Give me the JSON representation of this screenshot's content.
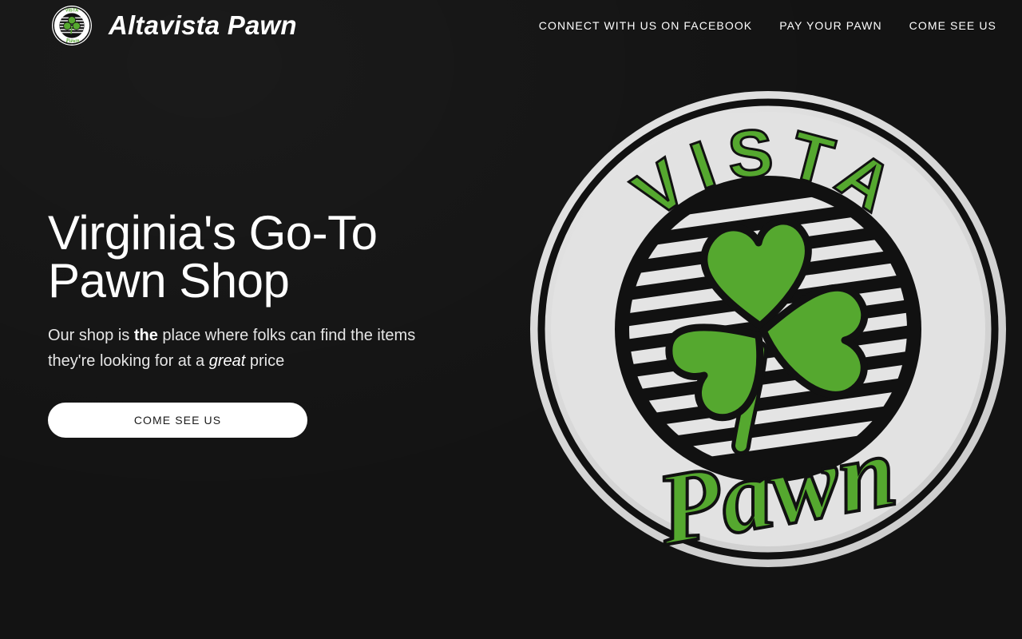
{
  "header": {
    "brand_name": "Altavista Pawn",
    "logo_icon": "vista-pawn-clover-logo-icon",
    "nav": [
      {
        "label": "CONNECT WITH US ON FACEBOOK"
      },
      {
        "label": "PAY YOUR PAWN"
      },
      {
        "label": "COME SEE US"
      }
    ]
  },
  "hero": {
    "title_line1": "Virginia's Go-To",
    "title_line2": "Pawn Shop",
    "subtitle_part1": "Our shop is ",
    "subtitle_bold": "the",
    "subtitle_part2": " place where folks can find the items they're looking for at a ",
    "subtitle_italic": "great",
    "subtitle_part3": " price",
    "cta_label": "COME SEE US"
  },
  "logo": {
    "arc_text": "VISTA",
    "script_text": "Pawn",
    "icon": "shamrock-icon"
  },
  "colors": {
    "background": "#131313",
    "clover_green": "#55a82f",
    "badge_light": "#e4e4e4",
    "button_bg": "#ffffff",
    "button_text": "#1a1a1a"
  }
}
